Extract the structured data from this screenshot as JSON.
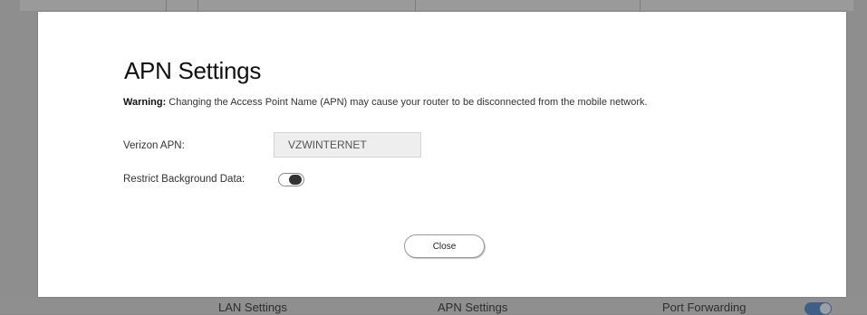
{
  "modal": {
    "title": "APN Settings",
    "warning_label": "Warning:",
    "warning_text": " Changing the Access Point Name (APN) may cause your router to be disconnected from the mobile network.",
    "apn_label": "Verizon APN:",
    "apn_value": "VZWINTERNET",
    "restrict_label": "Restrict Background Data:",
    "restrict_enabled": false,
    "close_label": "Close"
  },
  "background": {
    "tiles": [
      {
        "label": "LAN Settings"
      },
      {
        "label": "APN Settings"
      },
      {
        "label": "Port Forwarding"
      }
    ],
    "port_forwarding_enabled": true,
    "toggle_color": "#3f5f86"
  }
}
